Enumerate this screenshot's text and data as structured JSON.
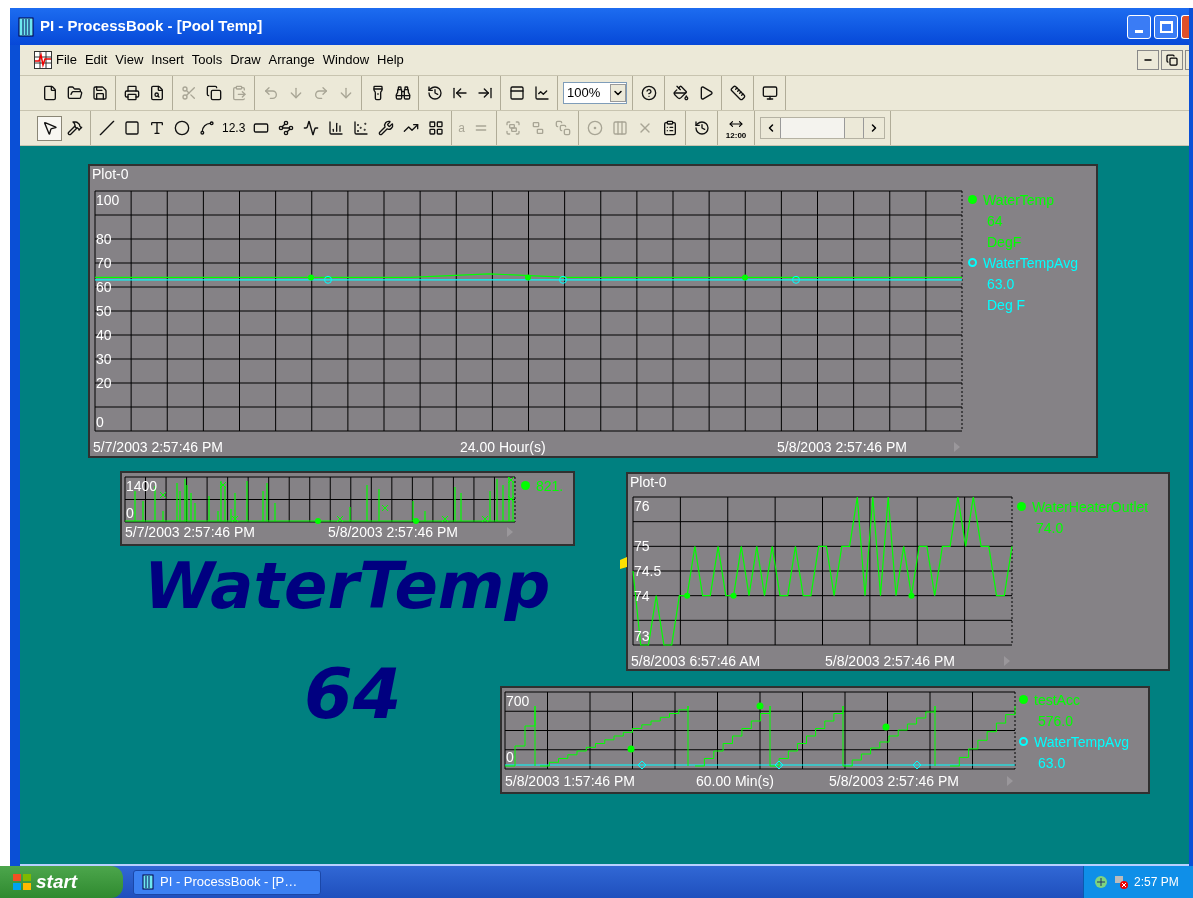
{
  "window": {
    "title": "PI - ProcessBook - [Pool Temp]"
  },
  "menu": [
    "File",
    "Edit",
    "View",
    "Insert",
    "Tools",
    "Draw",
    "Arrange",
    "Window",
    "Help"
  ],
  "toolbar_1": [
    [
      {
        "kind": "icon",
        "disabled": false
      },
      {
        "kind": "icon",
        "disabled": false
      },
      {
        "kind": "icon",
        "disabled": false
      }
    ],
    [
      {
        "kind": "icon",
        "disabled": false
      },
      {
        "kind": "icon",
        "disabled": false
      }
    ],
    [
      {
        "kind": "icon",
        "disabled": true
      },
      {
        "kind": "icon",
        "disabled": false
      },
      {
        "kind": "icon",
        "disabled": true
      }
    ],
    [
      {
        "kind": "icon",
        "disabled": true
      },
      {
        "kind": "icon",
        "disabled": true
      },
      {
        "kind": "icon",
        "disabled": true
      },
      {
        "kind": "icon",
        "disabled": true
      }
    ],
    [
      {
        "kind": "icon",
        "disabled": false
      },
      {
        "kind": "icon",
        "disabled": false
      }
    ],
    [
      {
        "kind": "icon",
        "disabled": false
      },
      {
        "kind": "icon",
        "disabled": false
      },
      {
        "kind": "icon",
        "disabled": false
      }
    ],
    [
      {
        "kind": "icon",
        "disabled": false
      },
      {
        "kind": "icon",
        "disabled": false
      }
    ],
    [
      {
        "kind": "combo",
        "value": "100%"
      }
    ],
    [
      {
        "kind": "icon",
        "disabled": false
      }
    ],
    [
      {
        "kind": "icon",
        "disabled": false
      },
      {
        "kind": "icon",
        "disabled": false
      }
    ],
    [
      {
        "kind": "icon",
        "disabled": false
      }
    ],
    [
      {
        "kind": "icon",
        "disabled": false
      }
    ]
  ],
  "toolbar_2": [
    [
      {
        "kind": "icon",
        "disabled": false,
        "selected": true
      },
      {
        "kind": "icon",
        "disabled": false,
        "selected": false
      }
    ],
    [
      {
        "kind": "icon",
        "disabled": false,
        "selected": false
      },
      {
        "kind": "icon",
        "disabled": false,
        "selected": false
      },
      {
        "kind": "icon",
        "disabled": false,
        "selected": false
      },
      {
        "kind": "icon",
        "disabled": false,
        "selected": false
      },
      {
        "kind": "icon",
        "disabled": false,
        "selected": false
      },
      {
        "kind": "text",
        "label": "12.3",
        "disabled": false,
        "selected": false
      },
      {
        "kind": "icon",
        "disabled": false,
        "selected": false
      },
      {
        "kind": "icon",
        "disabled": false,
        "selected": false
      },
      {
        "kind": "icon",
        "disabled": false,
        "selected": false
      },
      {
        "kind": "icon",
        "disabled": false,
        "selected": false
      },
      {
        "kind": "icon",
        "disabled": false,
        "selected": false
      },
      {
        "kind": "icon",
        "disabled": false,
        "selected": false
      },
      {
        "kind": "icon",
        "disabled": false,
        "selected": false
      },
      {
        "kind": "icon",
        "disabled": false,
        "selected": false
      }
    ],
    [
      {
        "kind": "text",
        "label": "a",
        "disabled": true,
        "selected": false
      },
      {
        "kind": "icon",
        "disabled": true,
        "selected": false
      }
    ],
    [
      {
        "kind": "icon",
        "disabled": true,
        "selected": false
      },
      {
        "kind": "icon",
        "disabled": true,
        "selected": false
      },
      {
        "kind": "icon",
        "disabled": true,
        "selected": false
      }
    ],
    [
      {
        "kind": "icon",
        "disabled": true,
        "selected": false
      },
      {
        "kind": "icon",
        "disabled": true,
        "selected": false
      },
      {
        "kind": "icon",
        "disabled": true,
        "selected": false
      },
      {
        "kind": "icon",
        "disabled": false,
        "selected": false
      }
    ],
    [
      {
        "kind": "icon",
        "disabled": false,
        "selected": false
      }
    ],
    [
      {
        "kind": "time",
        "label": "12:00",
        "disabled": false,
        "selected": false
      }
    ],
    [
      {
        "kind": "scroll"
      }
    ]
  ],
  "plots": [
    {
      "title": "Plot-0",
      "x_labels": [
        "5/7/2003 2:57:46 PM",
        "24.00 Hour(s)",
        "5/8/2003 2:57:46 PM"
      ],
      "chart_data": {
        "type": "line",
        "categories": [
          null,
          null,
          null,
          null,
          null,
          null,
          null,
          null,
          null,
          null,
          null,
          null
        ],
        "series": [
          {
            "name": "WaterTemp",
            "color": "#00ff00",
            "values": [
              64,
              64,
              64,
              64,
              64,
              65.5,
              64,
              64,
              64,
              64,
              64,
              64
            ]
          },
          {
            "name": "WaterTempAvg",
            "color": "#00ffff",
            "values": [
              63,
              63,
              63,
              63,
              63,
              63,
              63,
              63,
              63,
              63,
              63,
              63
            ]
          }
        ],
        "ylim": [
          0,
          100
        ],
        "grid": true,
        "legend": "right",
        "yticks": [
          {
            "value": 100,
            "label": "100"
          },
          {
            "value": 80,
            "label": "80"
          },
          {
            "value": 70,
            "label": "70"
          },
          {
            "value": 60,
            "label": "60"
          },
          {
            "value": 50,
            "label": "50"
          },
          {
            "value": 40,
            "label": "40"
          },
          {
            "value": 30,
            "label": "30"
          },
          {
            "value": 20,
            "label": "20"
          },
          {
            "value": 0,
            "label": "0"
          }
        ]
      },
      "legend": [
        {
          "kind": "filled",
          "lines": [
            "64",
            "DegF"
          ]
        },
        {
          "kind": "open",
          "lines": [
            "63.0",
            "Deg F"
          ]
        }
      ]
    },
    {
      "y_ticks": [
        "1400",
        "0"
      ],
      "x_labels": [
        "5/7/2003 2:57:46 PM",
        "5/8/2003 2:57:46 PM"
      ],
      "legend": [
        {
          "kind": "filled",
          "color": "#00ff00",
          "lines": [
            "821."
          ]
        }
      ]
    },
    {
      "title": "Plot-0",
      "x_labels": [
        "5/8/2003 6:57:46 AM",
        "5/8/2003 2:57:46 PM"
      ],
      "chart_data": {
        "type": "line",
        "categories": [
          null,
          null,
          null,
          null,
          null,
          null,
          null,
          null,
          null,
          null,
          null,
          null,
          null,
          null,
          null,
          null,
          null,
          null,
          null,
          null,
          null,
          null,
          null,
          null,
          null,
          null,
          null,
          null,
          null,
          null,
          null,
          null,
          null,
          null,
          null,
          null,
          null,
          null,
          null,
          null,
          null,
          null,
          null,
          null,
          null,
          null,
          null,
          null,
          null,
          null
        ],
        "series": [
          {
            "name": "WaterHeaterOutlet",
            "color": "#00ff00",
            "values": [
              74.5,
              73,
              73,
              74,
              73,
              73,
              74,
              74,
              75,
              74,
              74,
              75,
              74,
              74,
              75,
              74,
              75,
              74,
              75,
              74,
              74,
              75,
              74,
              74,
              75,
              75,
              74,
              75,
              75,
              76,
              74,
              76,
              74,
              76,
              74,
              75,
              74,
              75,
              75,
              74,
              75,
              75,
              76,
              75,
              76,
              75,
              75,
              74,
              74,
              75
            ]
          }
        ],
        "ylim": [
          73,
          76
        ],
        "grid": true,
        "legend": "right",
        "yticks": [
          {
            "value": 76,
            "label": "76"
          },
          {
            "value": 75,
            "label": "75"
          },
          {
            "value": 74.5,
            "label": "74.5"
          },
          {
            "value": 74,
            "label": "74"
          },
          {
            "value": 73,
            "label": "73"
          }
        ]
      },
      "legend": [
        {
          "kind": "filled",
          "lines": [
            "74.0"
          ]
        }
      ]
    },
    {
      "y_ticks": [
        "700",
        "0"
      ],
      "x_labels": [
        "5/8/2003 1:57:46 PM",
        "60.00 Min(s)",
        "5/8/2003 2:57:46 PM"
      ],
      "legend": [
        {
          "kind": "filled",
          "color": "#00ff00",
          "lines": [
            "testAcc",
            "576.0"
          ]
        },
        {
          "kind": "open",
          "color": "#00ffff",
          "lines": [
            "WaterTempAvg",
            "63.0"
          ]
        }
      ]
    }
  ],
  "value_display": {
    "tag": "WaterTemp",
    "value": "64"
  },
  "taskbar": {
    "start": "start",
    "tasks": [
      "PI - ProcessBook - [P…"
    ],
    "clock": "2:57 PM"
  }
}
